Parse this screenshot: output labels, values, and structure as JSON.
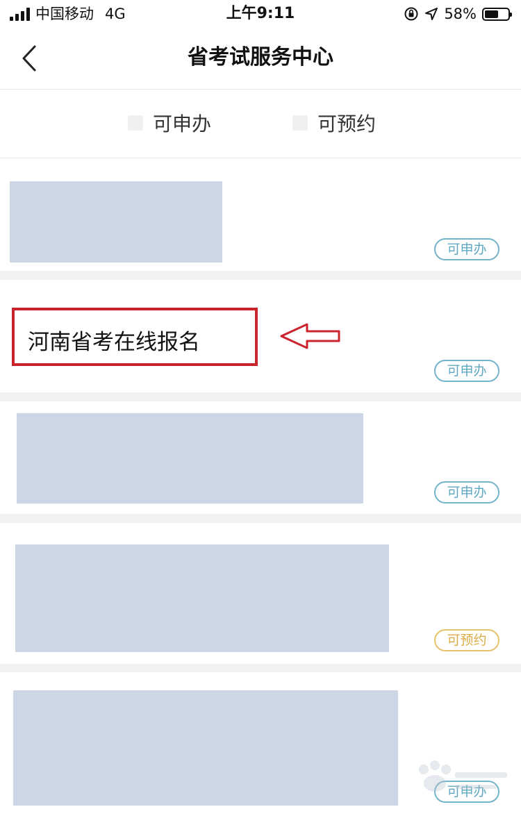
{
  "status_bar": {
    "carrier": "中国移动",
    "network": "4G",
    "time": "上午9:11",
    "battery_percent": "58%",
    "battery_level": 0.58,
    "icons": [
      "signal-icon",
      "orientation-lock-icon",
      "location-icon",
      "battery-icon"
    ]
  },
  "nav": {
    "title": "省考试服务中心",
    "back_icon": "chevron-left-icon"
  },
  "filters": [
    {
      "label": "可申办",
      "checked": false
    },
    {
      "label": "可预约",
      "checked": false
    }
  ],
  "cards": [
    {
      "title": "",
      "badge": "可申办",
      "badge_type": "apply"
    },
    {
      "title": "河南省考在线报名",
      "badge": "可申办",
      "badge_type": "apply"
    },
    {
      "title": "",
      "badge": "可申办",
      "badge_type": "apply"
    },
    {
      "title": "",
      "badge": "可预约",
      "badge_type": "appoint"
    },
    {
      "title": "",
      "badge": "可申办",
      "badge_type": "apply"
    }
  ],
  "colors": {
    "badge_apply": "#74b4cb",
    "badge_appoint": "#e7c46a",
    "highlight": "#c9242d",
    "placeholder": "#ccd6e5",
    "divider": "#f2f2f2"
  }
}
